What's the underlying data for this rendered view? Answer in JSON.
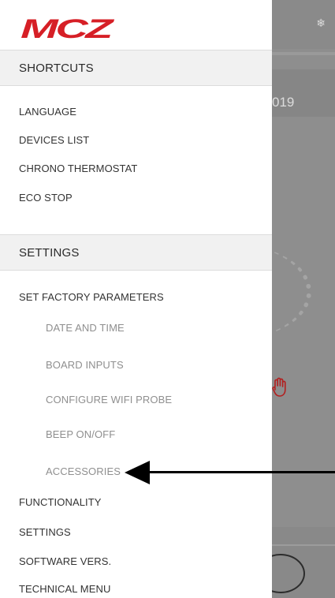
{
  "brand": {
    "logo_text": "MCZ",
    "logo_color": "#d61f26"
  },
  "background": {
    "date_fragment": "019",
    "dim_color": "#8e8e8e",
    "hand_color": "#b31f1f"
  },
  "drawer": {
    "shortcuts_header": "SHORTCUTS",
    "shortcuts": [
      {
        "label": "LANGUAGE"
      },
      {
        "label": "DEVICES LIST"
      },
      {
        "label": "CHRONO THERMOSTAT"
      },
      {
        "label": "ECO STOP"
      }
    ],
    "settings_header": "SETTINGS",
    "settings": [
      {
        "label": "SET FACTORY PARAMETERS"
      },
      {
        "label": "DATE AND TIME"
      },
      {
        "label": "BOARD INPUTS"
      },
      {
        "label": "CONFIGURE WIFI PROBE"
      },
      {
        "label": "BEEP ON/OFF"
      },
      {
        "label": "ACCESSORIES"
      },
      {
        "label": "FUNCTIONALITY"
      },
      {
        "label": "SETTINGS"
      },
      {
        "label": "SOFTWARE VERS."
      },
      {
        "label": "TECHNICAL MENU"
      }
    ]
  },
  "colors": {
    "header_bg": "#f1f1f1",
    "item_text": "#333333",
    "sub_item_text": "#8f8f8f",
    "annotation": "#000000"
  }
}
